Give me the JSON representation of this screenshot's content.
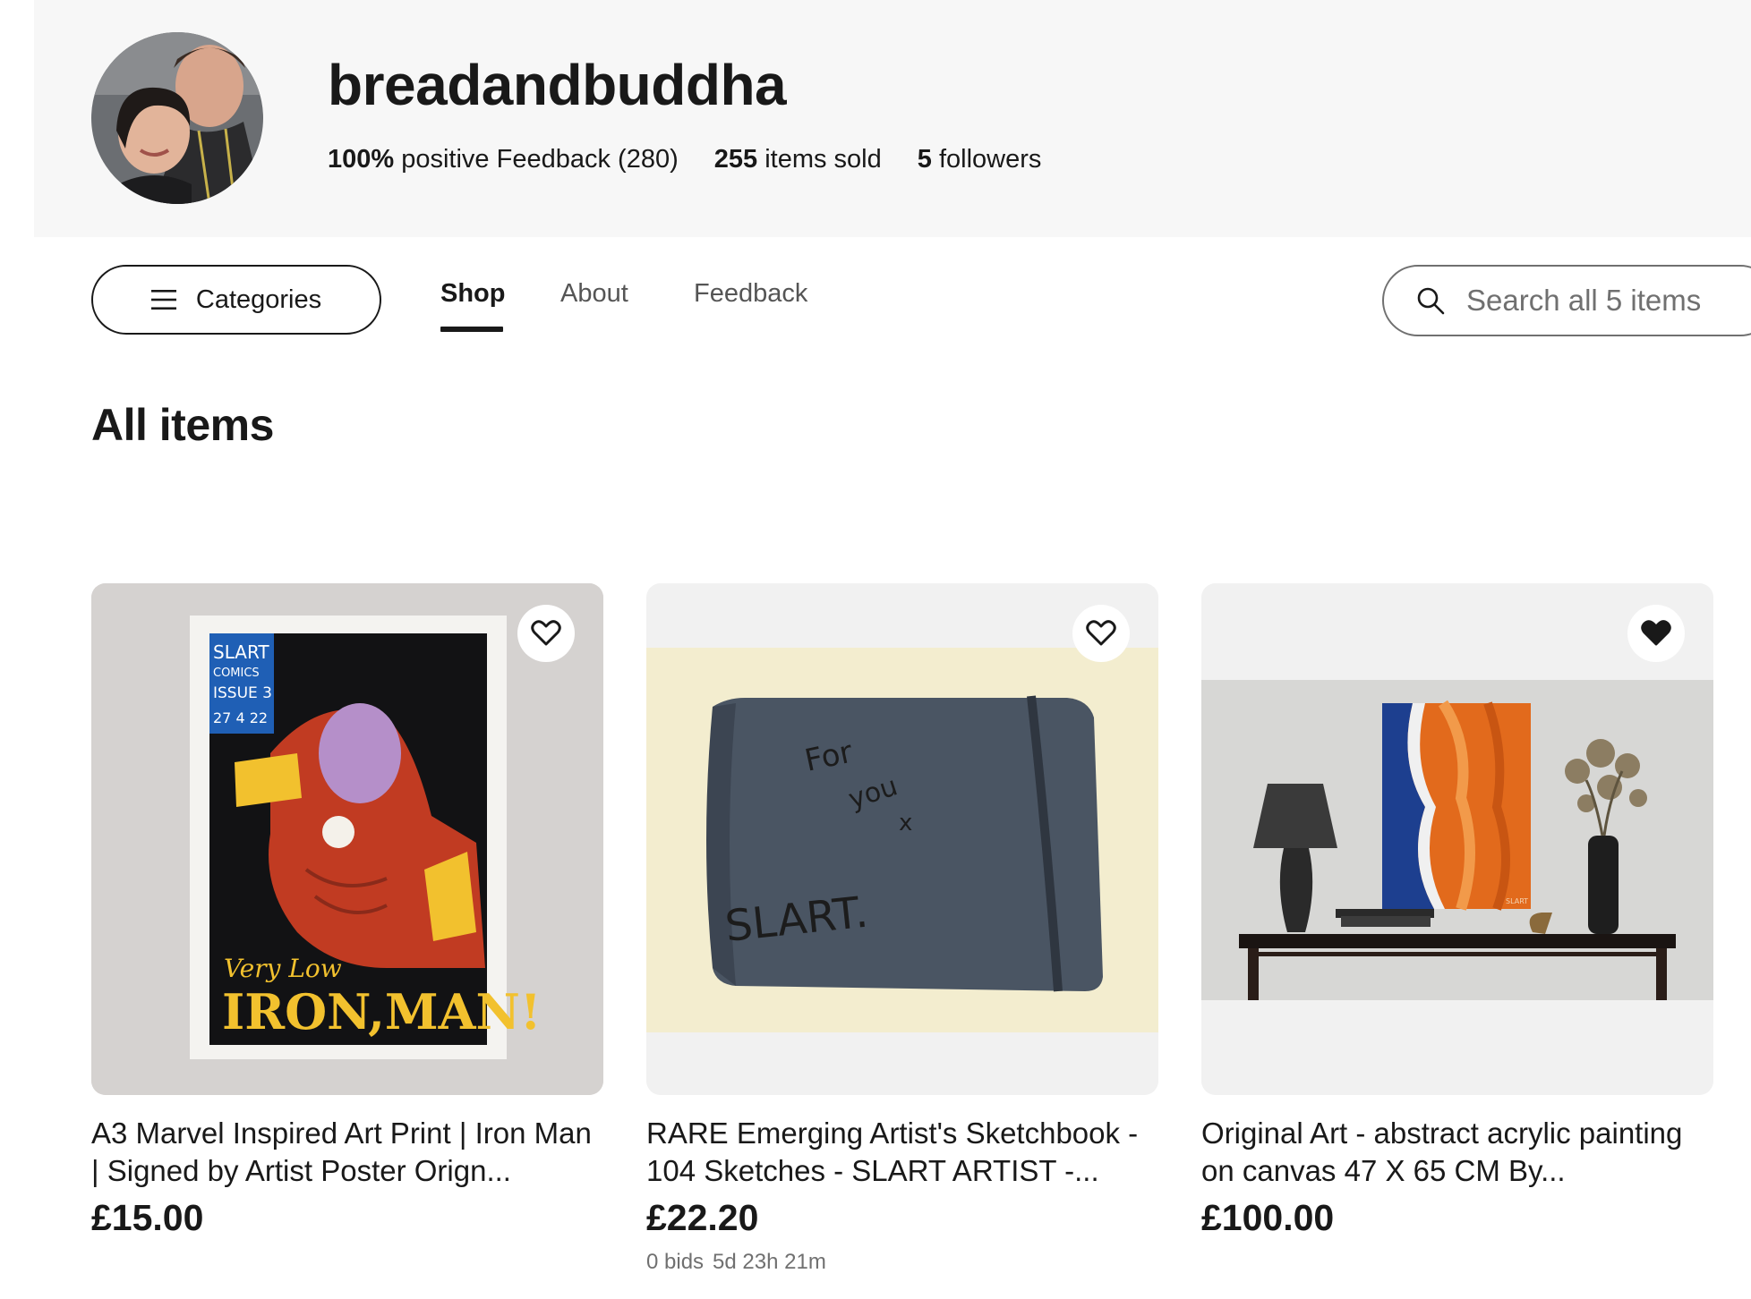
{
  "seller": {
    "name": "breadandbuddha",
    "feedback_percent": "100%",
    "feedback_text": "positive Feedback (280)",
    "items_sold_count": "255",
    "items_sold_text": "items sold",
    "followers_count": "5",
    "followers_text": "followers"
  },
  "nav": {
    "categories_label": "Categories",
    "tabs": [
      {
        "label": "Shop",
        "active": true
      },
      {
        "label": "About",
        "active": false
      },
      {
        "label": "Feedback",
        "active": false
      }
    ],
    "search_placeholder": "Search all 5 items"
  },
  "section_title": "All items",
  "items": [
    {
      "title": "A3 Marvel Inspired Art Print | Iron Man | Signed by Artist Poster Orign...",
      "price": "£15.00",
      "watched": false,
      "image": {
        "comic_lines": [
          "SLART",
          "COMICS",
          "ISSUE 3",
          "27 4 22"
        ],
        "subtitle": "Very Low",
        "title": "IRON,MAN!"
      }
    },
    {
      "title": "RARE Emerging Artist's Sketchbook - 104 Sketches - SLART ARTIST -...",
      "price": "£22.20",
      "watched": false,
      "bids": "0 bids",
      "time_left": "5d 23h 21m",
      "image": {
        "note_lines": [
          "For",
          "you",
          "x"
        ],
        "signature": "SLART."
      }
    },
    {
      "title": "Original Art - abstract acrylic painting on canvas 47 X 65 CM By...",
      "price": "£100.00",
      "watched": true,
      "image": {
        "signature": "SLART"
      }
    }
  ],
  "colors": {
    "text": "#191919",
    "muted": "#707070",
    "header_bg": "#f7f7f7"
  }
}
